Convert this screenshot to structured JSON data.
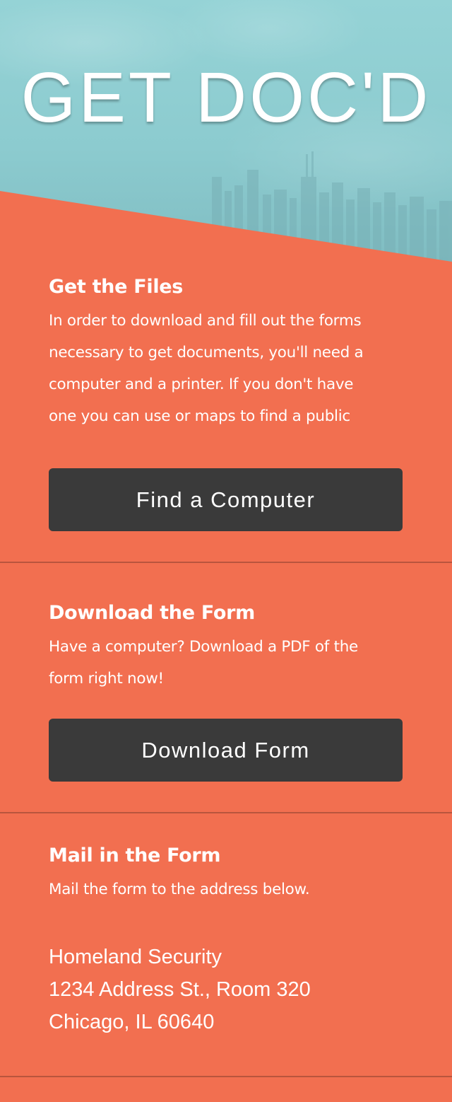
{
  "hero": {
    "title": "GET DOC'D"
  },
  "sections": [
    {
      "heading": "Get the Files",
      "body_lines": [
        "In order to download and fill out the forms",
        "necessary to get documents, you'll need a",
        "computer and a printer. If you don't have",
        "one you can use or maps to find a public"
      ],
      "button_label": "Find a Computer"
    },
    {
      "heading": "Download the Form",
      "body_lines": [
        "Have a computer? Download a PDF of the",
        "form right now!"
      ],
      "button_label": "Download Form"
    },
    {
      "heading": "Mail in the Form",
      "body_lines": [
        "Mail the form to the address below."
      ],
      "address_lines": [
        "Homeland Security",
        "1234 Address St., Room 320",
        "Chicago, IL 60640"
      ]
    }
  ],
  "colors": {
    "background": "#f26f50",
    "hero_sky": "#95d3d6",
    "button": "#3a3a3a",
    "divider": "#b9553d",
    "text": "#ffffff"
  }
}
